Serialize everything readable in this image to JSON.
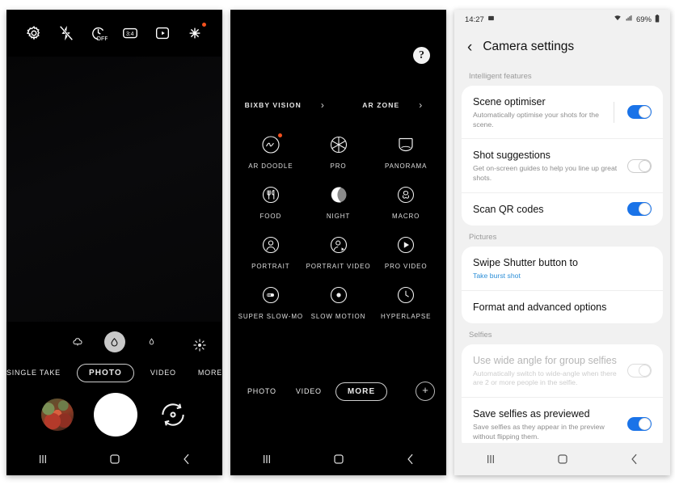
{
  "panel_camera": {
    "name": "Camera viewfinder",
    "top_icons": [
      {
        "name": "settings-gear-icon",
        "label": "Settings"
      },
      {
        "name": "flash-off-icon",
        "label": "Flash off"
      },
      {
        "name": "timer-off-icon",
        "label": "Timer off",
        "text": "OFF"
      },
      {
        "name": "aspect-ratio-icon",
        "label": "Aspect ratio",
        "text": "3:4"
      },
      {
        "name": "motion-photo-icon",
        "label": "Motion photo"
      },
      {
        "name": "filters-icon",
        "label": "Filters and effects"
      }
    ],
    "zoom_levels": [
      {
        "name": "zoom-ultrawide",
        "selected": false
      },
      {
        "name": "zoom-wide",
        "selected": true
      },
      {
        "name": "zoom-tele",
        "selected": false
      }
    ],
    "beauty_icon": "beauty-effects-icon",
    "modes": [
      {
        "label": "SINGLE TAKE",
        "active": false
      },
      {
        "label": "PHOTO",
        "active": true
      },
      {
        "label": "VIDEO",
        "active": false
      },
      {
        "label": "MORE",
        "active": false
      }
    ],
    "controls": {
      "gallery_thumb": "gallery-thumbnail",
      "shutter": "shutter-button",
      "flip": "switch-camera-button"
    },
    "nav": {
      "recents": "recents-button",
      "home": "home-button",
      "back": "back-button"
    }
  },
  "panel_more": {
    "name": "More camera modes",
    "help_label": "?",
    "shortcuts": [
      {
        "label": "BIXBY VISION",
        "chevron": "›"
      },
      {
        "label": "AR ZONE",
        "chevron": "›"
      }
    ],
    "modes_grid": [
      [
        {
          "label": "AR DOODLE",
          "icon": "ar-doodle-icon",
          "badge": true
        },
        {
          "label": "PRO",
          "icon": "pro-icon",
          "badge": false
        },
        {
          "label": "PANORAMA",
          "icon": "panorama-icon",
          "badge": false
        }
      ],
      [
        {
          "label": "FOOD",
          "icon": "food-icon",
          "badge": false
        },
        {
          "label": "NIGHT",
          "icon": "night-icon",
          "badge": false
        },
        {
          "label": "MACRO",
          "icon": "macro-icon",
          "badge": false
        }
      ],
      [
        {
          "label": "PORTRAIT",
          "icon": "portrait-icon",
          "badge": false
        },
        {
          "label": "PORTRAIT VIDEO",
          "icon": "portrait-video-icon",
          "badge": false
        },
        {
          "label": "PRO VIDEO",
          "icon": "pro-video-icon",
          "badge": false
        }
      ],
      [
        {
          "label": "SUPER SLOW-MO",
          "icon": "super-slow-mo-icon",
          "badge": false
        },
        {
          "label": "SLOW MOTION",
          "icon": "slow-motion-icon",
          "badge": false
        },
        {
          "label": "HYPERLAPSE",
          "icon": "hyperlapse-icon",
          "badge": false
        }
      ]
    ],
    "tabs": [
      {
        "label": "PHOTO",
        "active": false
      },
      {
        "label": "VIDEO",
        "active": false
      },
      {
        "label": "MORE",
        "active": true
      }
    ],
    "add_button": "+",
    "nav": {
      "recents": "recents-button",
      "home": "home-button",
      "back": "back-button"
    }
  },
  "panel_settings": {
    "name": "Camera settings",
    "status_bar": {
      "time": "14:27",
      "battery": "69%"
    },
    "title": "Camera settings",
    "back": "‹",
    "sections": [
      {
        "header": "Intelligent features",
        "items": [
          {
            "title": "Scene optimiser",
            "subtitle": "Automatically optimise your shots for the scene.",
            "toggle": "on",
            "divider": true,
            "disabled": false
          },
          {
            "title": "Shot suggestions",
            "subtitle": "Get on-screen guides to help you line up great shots.",
            "toggle": "off",
            "divider": false,
            "disabled": false
          },
          {
            "title": "Scan QR codes",
            "subtitle": "",
            "toggle": "on",
            "divider": false,
            "disabled": false
          }
        ]
      },
      {
        "header": "Pictures",
        "items": [
          {
            "title": "Swipe Shutter button to",
            "subtitle": "Take burst shot",
            "subtitle_accent": true,
            "toggle": "none",
            "divider": false,
            "disabled": false
          },
          {
            "title": "Format and advanced options",
            "subtitle": "",
            "toggle": "none",
            "divider": false,
            "disabled": false
          }
        ]
      },
      {
        "header": "Selfies",
        "items": [
          {
            "title": "Use wide angle for group selfies",
            "subtitle": "Automatically switch to wide-angle when there are 2 or more people in the selfie.",
            "toggle": "off",
            "divider": false,
            "disabled": true
          },
          {
            "title": "Save selfies as previewed",
            "subtitle": "Save selfies as they appear in the preview without flipping them.",
            "toggle": "on",
            "divider": false,
            "disabled": false
          }
        ]
      }
    ],
    "nav": {
      "recents": "recents-button",
      "home": "home-button",
      "back": "back-button"
    }
  },
  "colors": {
    "accent_blue": "#1a73e8",
    "link_blue": "#2d8fd8",
    "badge_orange": "#f4511e",
    "page_bg": "#f1f1f1"
  }
}
